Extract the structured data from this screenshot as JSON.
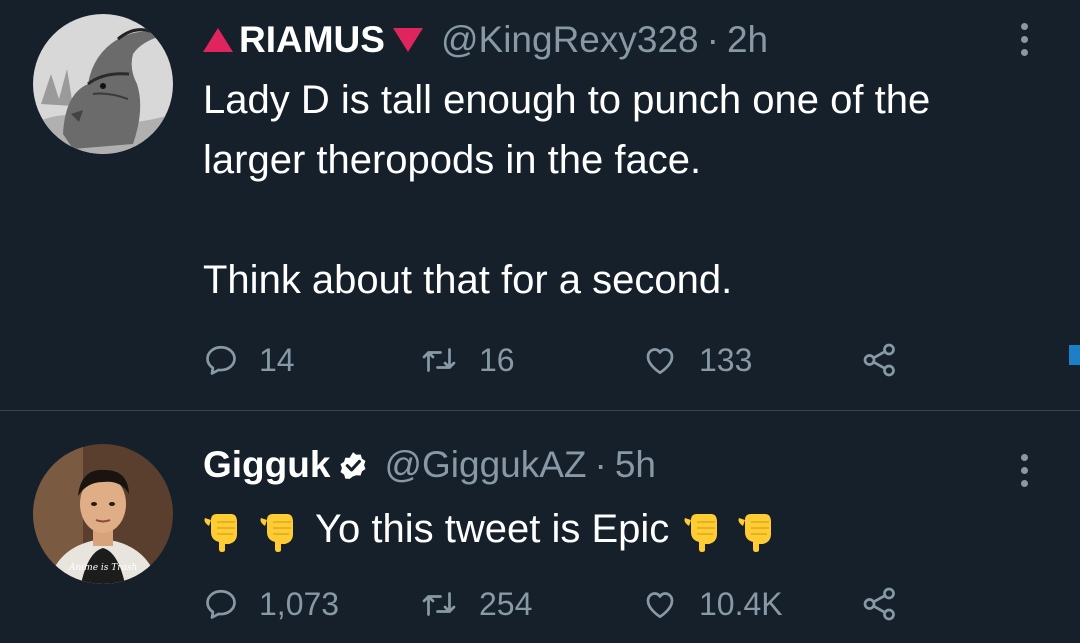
{
  "tweets": [
    {
      "display_name": "RIAMUS",
      "handle": "@KingRexy328",
      "separator": "·",
      "time": "2h",
      "text": "Lady D is tall enough to punch one of the\nlarger theropods in the face.\n\nThink about that for a second.",
      "stats": {
        "replies": "14",
        "retweets": "16",
        "likes": "133"
      }
    },
    {
      "display_name": "Gigguk",
      "handle": "@GiggukAZ",
      "separator": "·",
      "time": "5h",
      "text": "Yo this tweet is Epic",
      "avatar_shirt_text": "Anime is Trash",
      "stats": {
        "replies": "1,073",
        "retweets": "254",
        "likes": "10.4K"
      }
    }
  ],
  "colors": {
    "background": "#15202b",
    "secondary_text": "#8899a6",
    "divider": "#38444d",
    "name_decoration": "#e0245e",
    "verified": "#ffffff",
    "emoji": "#ffcc33",
    "edge_marker": "#1d7fc6"
  },
  "icons": {
    "more": "vertical-ellipsis-icon",
    "reply": "speech-bubble-icon",
    "retweet": "retweet-arrows-icon",
    "like": "heart-icon",
    "share": "share-nodes-icon",
    "verified": "verified-badge-icon",
    "emoji": "backhand-index-pointing-down-emoji"
  }
}
